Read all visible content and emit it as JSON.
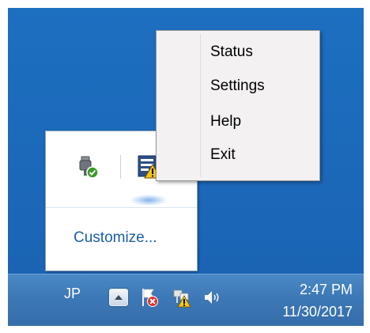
{
  "context_menu": {
    "items": [
      "Status",
      "Settings",
      "Help",
      "Exit"
    ]
  },
  "tray_panel": {
    "customize_label": "Customize...",
    "icons": [
      "usb-connected-icon",
      "network-warning-icon"
    ]
  },
  "taskbar": {
    "language": "JP",
    "icons": [
      "show-hidden-icons-icon",
      "action-center-error-icon",
      "network-warning-icon",
      "volume-icon"
    ],
    "clock": {
      "time": "2:47 PM",
      "date": "11/30/2017"
    }
  },
  "colors": {
    "desktop": "#1b64b4",
    "taskbar": "#3d78b6",
    "menu_background": "#f3f1f1",
    "link": "#1a5fa7",
    "warning": "#f5c518",
    "error": "#d9342b",
    "ok": "#3a9b2a"
  }
}
